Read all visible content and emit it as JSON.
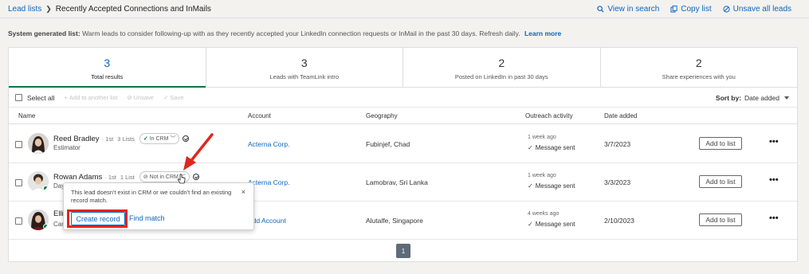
{
  "breadcrumb": {
    "root": "Lead lists",
    "current": "Recently Accepted Connections and InMails"
  },
  "top_actions": [
    {
      "label": "View in search",
      "icon": "search-icon"
    },
    {
      "label": "Copy list",
      "icon": "copy-icon"
    },
    {
      "label": "Unsave all leads",
      "icon": "unsave-icon"
    }
  ],
  "system_note": {
    "prefix": "System generated list:",
    "text": "Warm leads to consider following-up with as they recently accepted your LinkedIn connection requests or InMail in the past 30 days. Refresh daily.",
    "link": "Learn more"
  },
  "stats": [
    {
      "value": "3",
      "label": "Total results",
      "active": true
    },
    {
      "value": "3",
      "label": "Leads with TeamLink intro"
    },
    {
      "value": "2",
      "label": "Posted on LinkedIn in past 30 days"
    },
    {
      "value": "2",
      "label": "Share experiences with you"
    }
  ],
  "toolbar": {
    "select_all": "Select all",
    "add_to_list": "Add to another list",
    "unsave": "Unsave",
    "save": "Save",
    "sort_label": "Sort by:",
    "sort_value": "Date added"
  },
  "columns": {
    "name": "Name",
    "account": "Account",
    "geography": "Geography",
    "outreach": "Outreach activity",
    "date": "Date added"
  },
  "rows": [
    {
      "name": "Reed Bradley",
      "degree": "· 1st",
      "lists": "3 Lists",
      "crm": "In CRM",
      "title": "Estimator",
      "account": "Acterna Corp.",
      "geo": "Fubinjef, Chad",
      "when": "1 week ago",
      "outreach": "Message sent",
      "date": "3/7/2023",
      "add": "Add to list"
    },
    {
      "name": "Rowan Adams",
      "degree": "· 1st",
      "lists": "1 List",
      "crm": "Not in CRM",
      "title": "Day Pro Technician",
      "account": "Acterna Corp.",
      "geo": "Lamobrav, Sri Lanka",
      "when": "1 week ago",
      "outreach": "Message sent",
      "date": "3/3/2023",
      "add": "Add to list"
    },
    {
      "name": "Ellie",
      "degree": "",
      "lists": "",
      "crm": "",
      "title": "Care",
      "account": "Add Account",
      "geo": "Alutalfe, Singapore",
      "when": "4 weeks ago",
      "outreach": "Message sent",
      "date": "2/10/2023",
      "add": "Add to list"
    }
  ],
  "pager": {
    "page": "1"
  },
  "popup": {
    "text": "This lead doesn't exist in CRM or we couldn't find an existing record match.",
    "close": "×",
    "create": "Create record",
    "find": "Find match"
  },
  "colors": {
    "accent": "#0a66c2",
    "success": "#057642",
    "highlight": "#e0261c"
  }
}
